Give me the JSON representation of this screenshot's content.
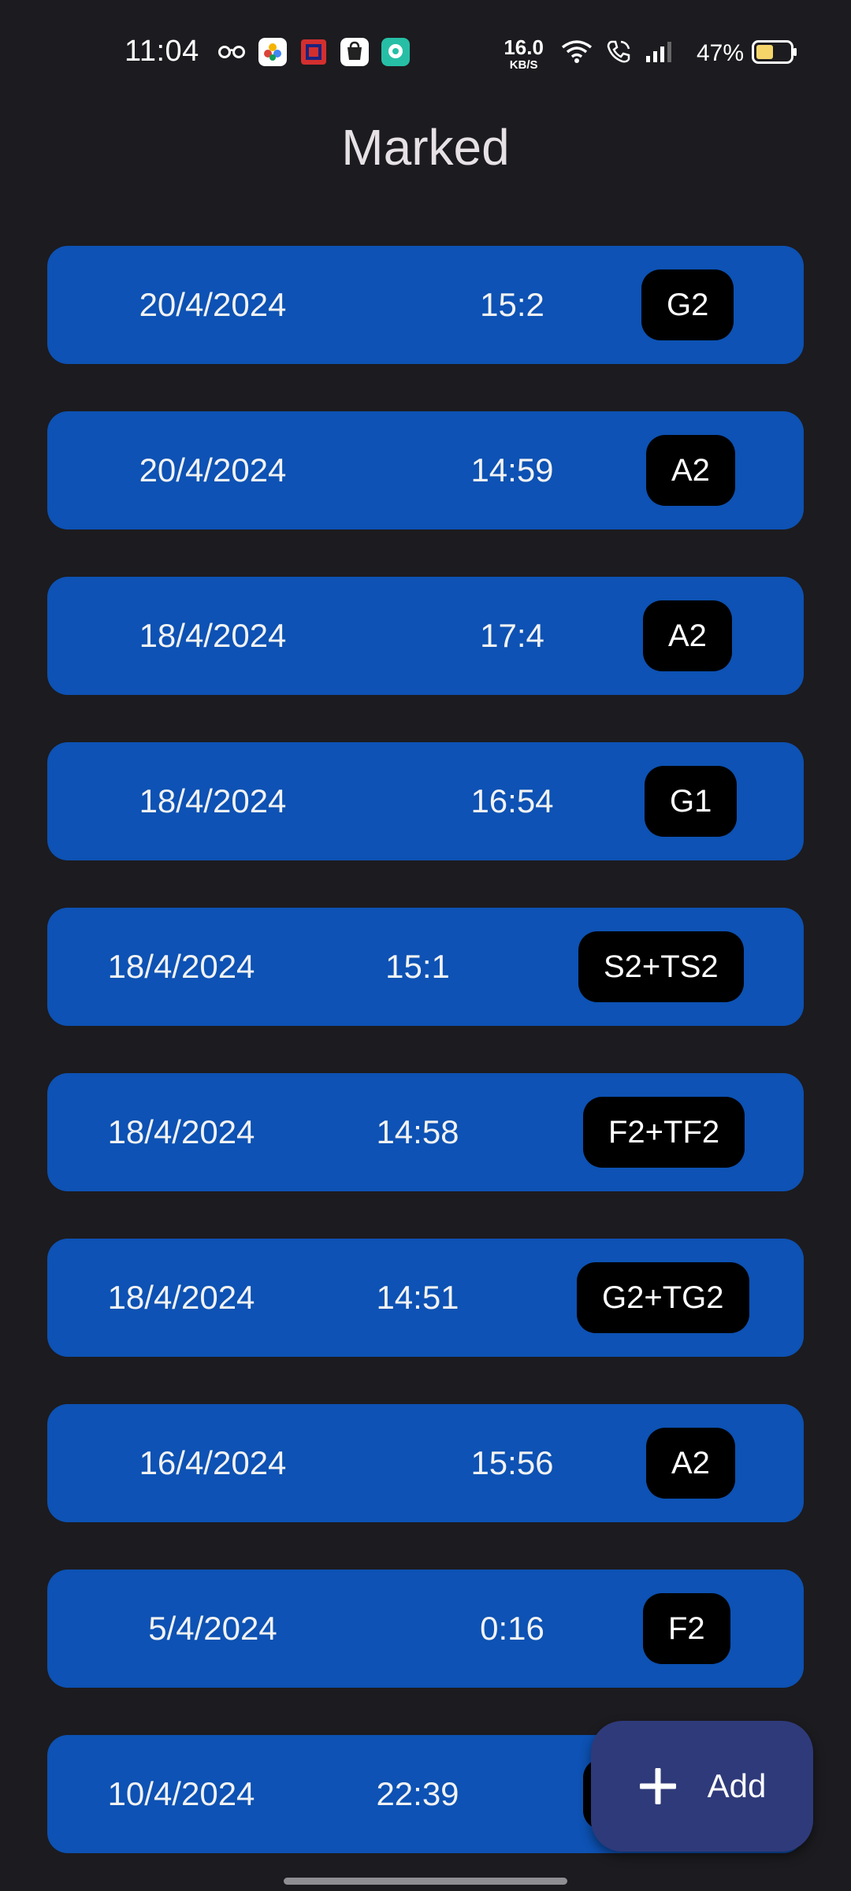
{
  "status_bar": {
    "time": "11:04",
    "network_speed_value": "16.0",
    "network_speed_unit": "KB/S",
    "battery_percent": "47%",
    "icons_left": [
      "glasses-icon",
      "photos-app-icon",
      "scanner-app-icon",
      "shopping-app-icon",
      "chat-app-icon"
    ],
    "icons_right": [
      "wifi-icon",
      "call-icon",
      "signal-icon",
      "battery-icon"
    ]
  },
  "page": {
    "title": "Marked"
  },
  "entries": [
    {
      "date": "20/4/2024",
      "time": "15:2",
      "tag": "G2"
    },
    {
      "date": "20/4/2024",
      "time": "14:59",
      "tag": "A2"
    },
    {
      "date": "18/4/2024",
      "time": "17:4",
      "tag": "A2"
    },
    {
      "date": "18/4/2024",
      "time": "16:54",
      "tag": "G1"
    },
    {
      "date": "18/4/2024",
      "time": "15:1",
      "tag": "S2+TS2"
    },
    {
      "date": "18/4/2024",
      "time": "14:58",
      "tag": "F2+TF2"
    },
    {
      "date": "18/4/2024",
      "time": "14:51",
      "tag": "G2+TG2"
    },
    {
      "date": "16/4/2024",
      "time": "15:56",
      "tag": "A2"
    },
    {
      "date": "5/4/2024",
      "time": "0:16",
      "tag": "F2"
    },
    {
      "date": "10/4/2024",
      "time": "22:39",
      "tag": ""
    }
  ],
  "fab": {
    "label": "Add",
    "icon": "plus-icon"
  },
  "colors": {
    "background": "#1c1b1f",
    "row": "#0d52b4",
    "badge": "#000000",
    "fab": "#2f3a7a"
  }
}
